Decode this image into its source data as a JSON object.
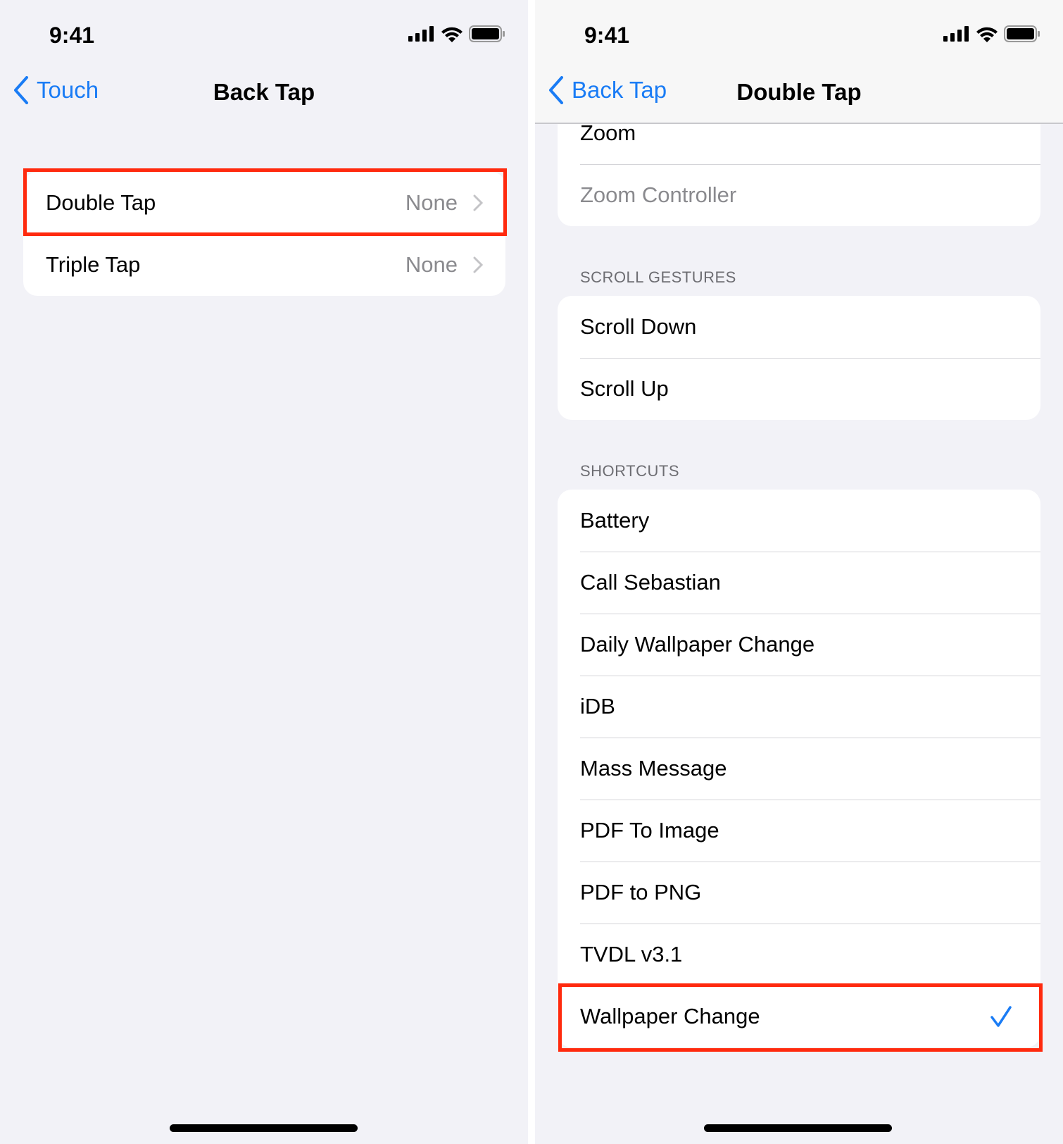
{
  "left": {
    "status": {
      "time": "9:41"
    },
    "nav": {
      "back_label": "Touch",
      "title": "Back Tap"
    },
    "rows": [
      {
        "label": "Double Tap",
        "value": "None"
      },
      {
        "label": "Triple Tap",
        "value": "None"
      }
    ]
  },
  "right": {
    "status": {
      "time": "9:41"
    },
    "nav": {
      "back_label": "Back Tap",
      "title": "Double Tap"
    },
    "top_rows": [
      {
        "label": "Zoom"
      },
      {
        "label": "Zoom Controller",
        "disabled": true
      }
    ],
    "scroll_gestures": {
      "header": "SCROLL GESTURES",
      "rows": [
        "Scroll Down",
        "Scroll Up"
      ]
    },
    "shortcuts": {
      "header": "SHORTCUTS",
      "rows": [
        "Battery",
        "Call Sebastian",
        "Daily Wallpaper Change",
        "iDB",
        "Mass Message",
        "PDF To Image",
        "PDF to PNG",
        "TVDL v3.1",
        "Wallpaper Change"
      ],
      "selected": "Wallpaper Change"
    }
  },
  "colors": {
    "accent": "#1a7cf5",
    "highlight": "#ff2a0e",
    "background": "#f2f2f7"
  }
}
